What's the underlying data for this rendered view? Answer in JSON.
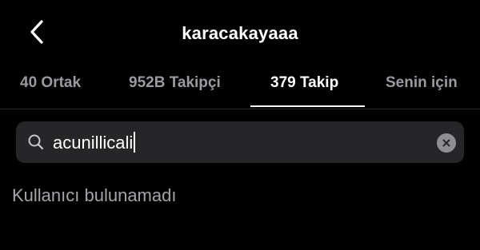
{
  "header": {
    "back_icon": "chevron-left-icon",
    "title": "karacakayaaa"
  },
  "tabs": [
    {
      "label": "40 Ortak",
      "active": false
    },
    {
      "label": "952B Takipçi",
      "active": false
    },
    {
      "label": "379 Takip",
      "active": true
    },
    {
      "label": "Senin için",
      "active": false
    }
  ],
  "search": {
    "value": "acunillicali",
    "search_icon": "search-icon",
    "clear_icon": "clear-icon"
  },
  "results": {
    "empty_message": "Kullanıcı bulunamadı"
  },
  "colors": {
    "background": "#000000",
    "search_bg": "#262629",
    "tab_inactive": "#9a9aa0",
    "tab_active": "#ffffff",
    "empty_text": "#a4a4aa"
  }
}
